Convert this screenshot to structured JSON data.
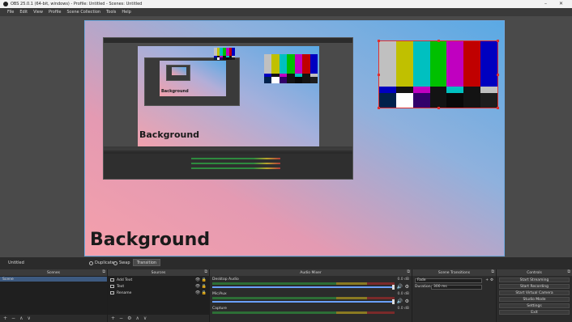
{
  "window": {
    "title": "OBS 25.0.1 (64-bit, windows) - Profile: Untitled - Scenes: Untitled",
    "minimize": "–",
    "close": "✕"
  },
  "menu": [
    "File",
    "Edit",
    "View",
    "Profile",
    "Scene Collection",
    "Tools",
    "Help"
  ],
  "preview": {
    "background_label": "Background",
    "nested_label": "Background",
    "nested2_label": "Background"
  },
  "controls_row": {
    "scene_name": "Untitled",
    "studio_mode_label": "Duplicate",
    "swap_label": "Swap",
    "transition_button": "Transition"
  },
  "docks": {
    "scenes": {
      "header": "Scenes",
      "items": [
        "Scene"
      ],
      "footer": [
        "+",
        "−",
        "∧",
        "∨"
      ]
    },
    "sources": {
      "header": "Sources",
      "items": [
        {
          "name": "Add Text"
        },
        {
          "name": "Text"
        },
        {
          "name": "Rename"
        }
      ],
      "footer": [
        "+",
        "−",
        "⚙",
        "∧",
        "∨"
      ]
    },
    "mixer": {
      "header": "Audio Mixer",
      "channels": [
        {
          "name": "Desktop Audio",
          "db": "0.0 dB"
        },
        {
          "name": "Mic/Aux",
          "db": "0.0 dB"
        },
        {
          "name": "Capture",
          "db": "0.0 dB"
        }
      ]
    },
    "transitions": {
      "header": "Scene Transitions",
      "type_value": "Fade",
      "duration_label": "Duration",
      "duration_value": "300 ms"
    },
    "controls": {
      "header": "Controls",
      "buttons": [
        "Start Streaming",
        "Start Recording",
        "Start Virtual Camera",
        "Studio Mode",
        "Settings",
        "Exit"
      ]
    }
  },
  "colorbars": {
    "top": [
      "#c0c0c0",
      "#c0c000",
      "#00c0c0",
      "#00c000",
      "#c000c0",
      "#c00000",
      "#0000c0"
    ],
    "mid": [
      "#0000c0",
      "#131313",
      "#c000c0",
      "#131313",
      "#00c0c0",
      "#131313",
      "#c0c0c0"
    ],
    "bot": [
      "#00214c",
      "#ffffff",
      "#32006a",
      "#131313",
      "#090909",
      "#131313",
      "#1d1d1d"
    ]
  }
}
